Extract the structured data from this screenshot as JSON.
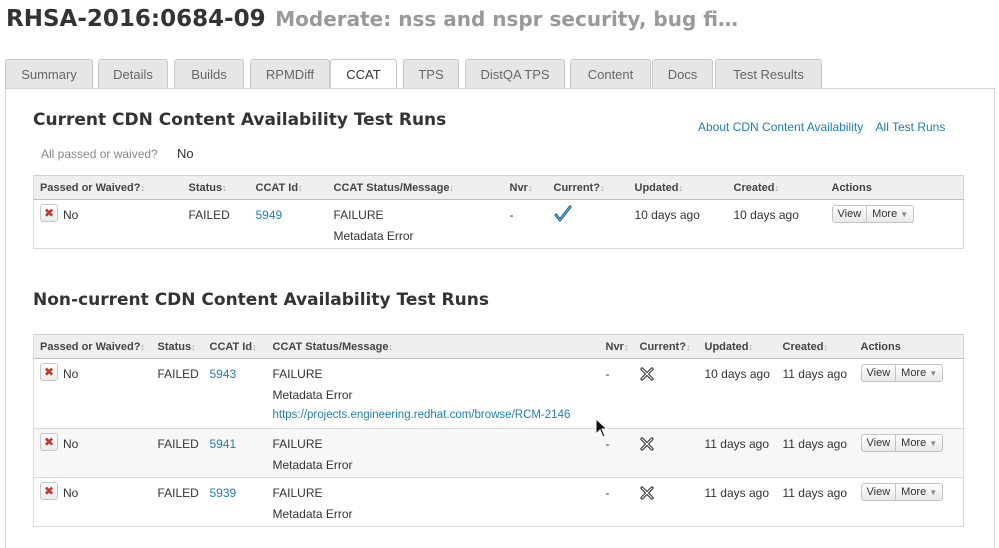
{
  "header": {
    "advisory": "RHSA-2016:0684-09",
    "synopsis": "Moderate: nss and nspr security, bug fi…"
  },
  "tabs": [
    {
      "label": "Summary"
    },
    {
      "label": "Details"
    },
    {
      "label": "Builds"
    },
    {
      "label": "RPMDiff"
    },
    {
      "label": "CCAT",
      "active": true
    },
    {
      "label": "TPS"
    },
    {
      "label": "DistQA TPS"
    },
    {
      "label": "Content"
    },
    {
      "label": "Docs"
    },
    {
      "label": "Test Results"
    }
  ],
  "current": {
    "title": "Current CDN Content Availability Test Runs",
    "about_link": "About CDN Content Availability",
    "all_runs_link": "All Test Runs",
    "all_passed_label": "All passed or waived?",
    "all_passed_value": "No",
    "columns": [
      "Passed or Waived?",
      "Status",
      "CCAT Id",
      "CCAT Status/Message",
      "Nvr",
      "Current?",
      "Updated",
      "Created",
      "Actions"
    ],
    "rows": [
      {
        "passed": "No",
        "status": "FAILED",
        "ccat_id": "5949",
        "message": "FAILURE",
        "detail": "Metadata Error",
        "nvr": "-",
        "current_icon": "check-icon",
        "updated": "10 days ago",
        "created": "10 days ago",
        "view": "View",
        "more": "More"
      }
    ]
  },
  "noncurrent": {
    "title": "Non-current CDN Content Availability Test Runs",
    "columns": [
      "Passed or Waived?",
      "Status",
      "CCAT Id",
      "CCAT Status/Message",
      "Nvr",
      "Current?",
      "Updated",
      "Created",
      "Actions"
    ],
    "rows": [
      {
        "passed": "No",
        "status": "FAILED",
        "ccat_id": "5943",
        "message": "FAILURE",
        "detail": "Metadata Error",
        "link": "https://projects.engineering.redhat.com/browse/RCM-2146",
        "nvr": "-",
        "current_icon": "cross-icon",
        "updated": "10 days ago",
        "created": "11 days ago",
        "view": "View",
        "more": "More"
      },
      {
        "passed": "No",
        "status": "FAILED",
        "ccat_id": "5941",
        "message": "FAILURE",
        "detail": "Metadata Error",
        "nvr": "-",
        "current_icon": "cross-icon",
        "updated": "11 days ago",
        "created": "11 days ago",
        "view": "View",
        "more": "More"
      },
      {
        "passed": "No",
        "status": "FAILED",
        "ccat_id": "5939",
        "message": "FAILURE",
        "detail": "Metadata Error",
        "nvr": "-",
        "current_icon": "cross-icon",
        "updated": "11 days ago",
        "created": "11 days ago",
        "view": "View",
        "more": "More"
      }
    ]
  },
  "colors": {
    "link": "#1f7fb0",
    "fail_x": "#c0392b",
    "check": "#1f5f9a"
  }
}
